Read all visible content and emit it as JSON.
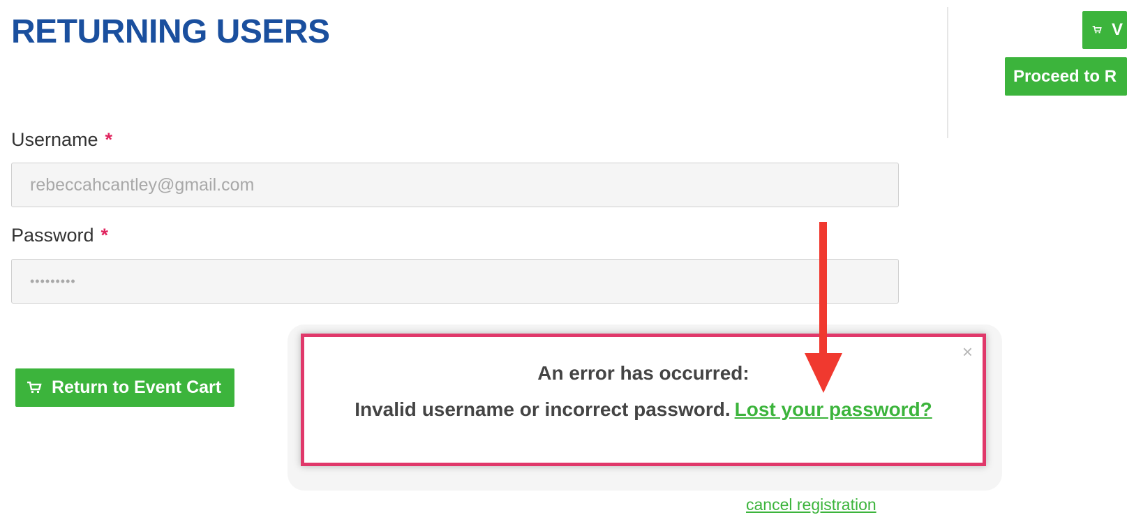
{
  "page": {
    "title": "RETURNING USERS"
  },
  "form": {
    "username": {
      "label": "Username",
      "required_mark": "*",
      "value": "rebeccahcantley@gmail.com"
    },
    "password": {
      "label": "Password",
      "required_mark": "*",
      "value": "•••••••••"
    }
  },
  "sidebar": {
    "view_cart_label": "V",
    "proceed_label": "Proceed to R"
  },
  "buttons": {
    "return_to_cart": "Return to Event Cart"
  },
  "error_modal": {
    "close_symbol": "×",
    "title": "An error has occurred:",
    "message": "Invalid username or incorrect password.",
    "link": "Lost your password?"
  },
  "links": {
    "cancel_registration": "cancel registration"
  },
  "colors": {
    "title_blue": "#1a4f9e",
    "green": "#3cb43c",
    "error_border": "#e0386a",
    "arrow_red": "#f0392f"
  }
}
